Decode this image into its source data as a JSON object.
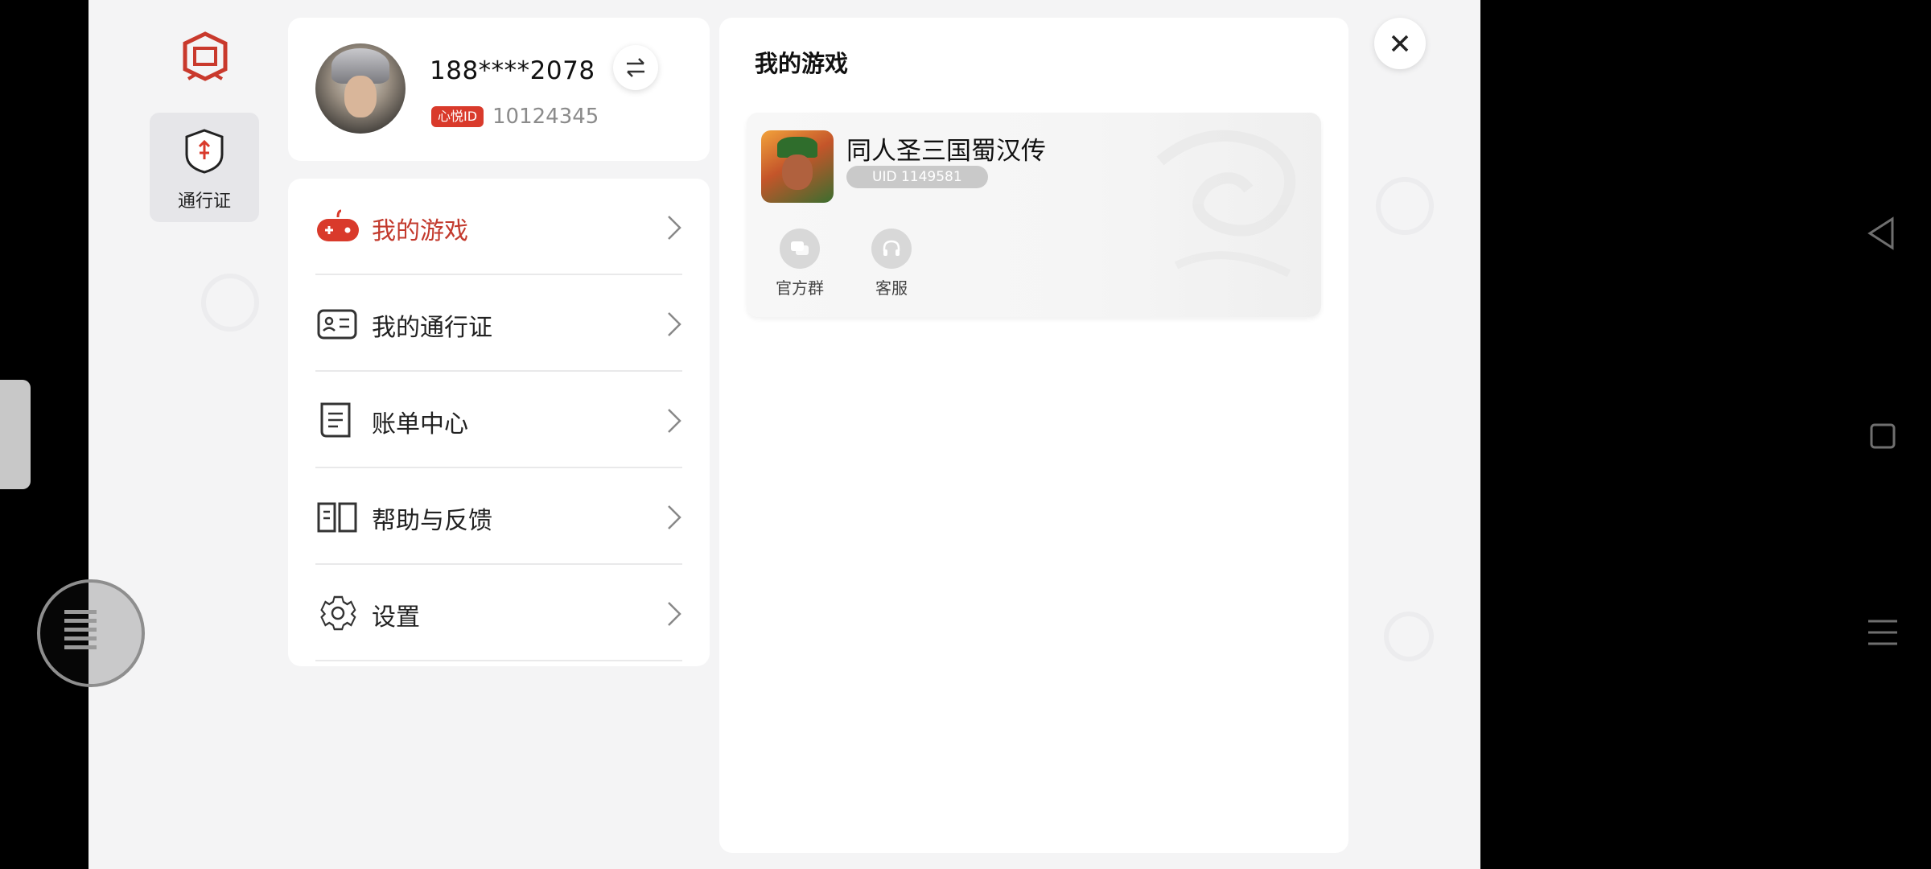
{
  "sidebar": {
    "pass_label": "通行证"
  },
  "user": {
    "phone": "188****2078",
    "id_badge": "心悦ID",
    "id_number": "10124345"
  },
  "menu": [
    {
      "label": "我的游戏",
      "icon": "gamepad-icon",
      "active": true
    },
    {
      "label": "我的通行证",
      "icon": "id-card-icon",
      "active": false
    },
    {
      "label": "账单中心",
      "icon": "bill-icon",
      "active": false
    },
    {
      "label": "帮助与反馈",
      "icon": "help-book-icon",
      "active": false
    },
    {
      "label": "设置",
      "icon": "gear-icon",
      "active": false
    }
  ],
  "games_section": {
    "title": "我的游戏",
    "game": {
      "name": "同人圣三国蜀汉传",
      "uid": "UID 1149581",
      "actions": [
        {
          "label": "官方群",
          "icon": "chat-group-icon"
        },
        {
          "label": "客服",
          "icon": "headset-icon"
        }
      ]
    }
  },
  "colors": {
    "accent": "#d93a2b",
    "active_text": "#c33a2d"
  }
}
